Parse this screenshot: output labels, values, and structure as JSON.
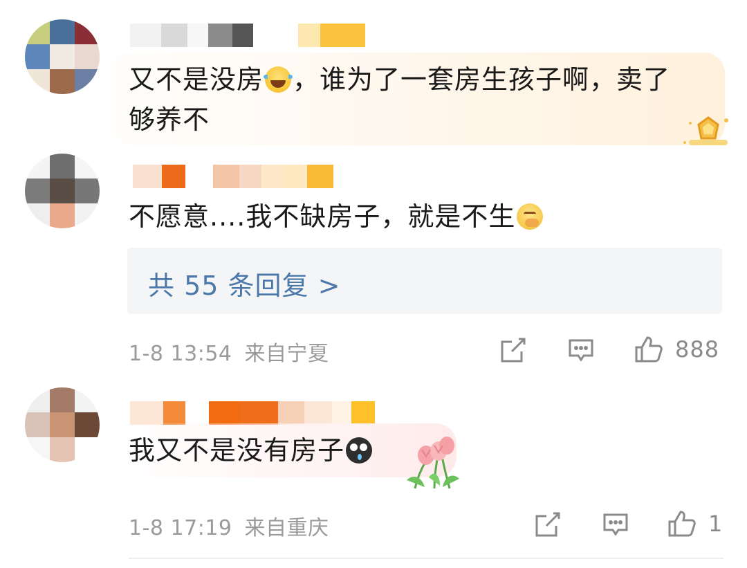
{
  "comments": [
    {
      "text_before_emoji": "又不是没房",
      "emoji": "laughing-crying",
      "text_line1_after": "，谁为了一套房生孩子啊，卖了",
      "text_line2": "够养不"
    },
    {
      "text": "不愿意....我不缺房子，就是不生",
      "emoji": "thinking",
      "reply_summary": "共 55 条回复 >",
      "timestamp": "1-8 13:54",
      "location": "来自宁夏",
      "like_count": "888"
    },
    {
      "text": "我又不是没有房子",
      "emoji": "crying",
      "timestamp": "1-8 17:19",
      "location": "来自重庆",
      "like_count": "1"
    }
  ],
  "colors": {
    "link": "#4c77a9",
    "meta": "#9a9a9a",
    "bubble_gold": "#fff1dc",
    "reply_bg": "#f4f5f7"
  },
  "icons": [
    "share-icon",
    "comment-icon",
    "like-icon",
    "badge-icon",
    "tulip-icon"
  ]
}
